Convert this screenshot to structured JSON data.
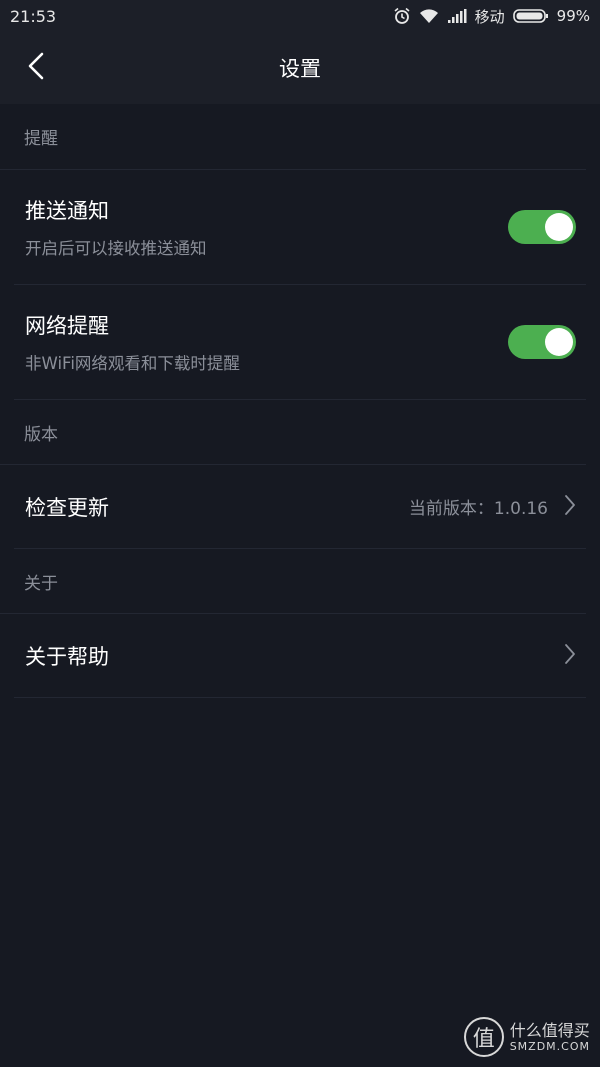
{
  "status_bar": {
    "time": "21:53",
    "carrier": "移动",
    "battery": "99%",
    "icons": [
      "alarm-icon",
      "wifi-icon",
      "signal-icon",
      "battery-icon"
    ]
  },
  "app_bar": {
    "title": "设置",
    "back_icon": "chevron-left-icon"
  },
  "sections": {
    "reminders": {
      "header": "提醒",
      "items": [
        {
          "title": "推送通知",
          "subtitle": "开启后可以接收推送通知",
          "toggle": "on"
        },
        {
          "title": "网络提醒",
          "subtitle": "非WiFi网络观看和下载时提醒",
          "toggle": "on"
        }
      ]
    },
    "version": {
      "header": "版本",
      "item": {
        "title": "检查更新",
        "value": "当前版本：1.0.16"
      }
    },
    "about": {
      "header": "关于",
      "item": {
        "title": "关于帮助"
      }
    }
  },
  "watermark": {
    "logo_char": "值",
    "cn": "什么值得买",
    "en": "SMZDM.COM"
  },
  "colors": {
    "background": "#161922",
    "bar": "#1c1f28",
    "toggle_on": "#4caf50",
    "muted_text": "#8b8f99"
  }
}
